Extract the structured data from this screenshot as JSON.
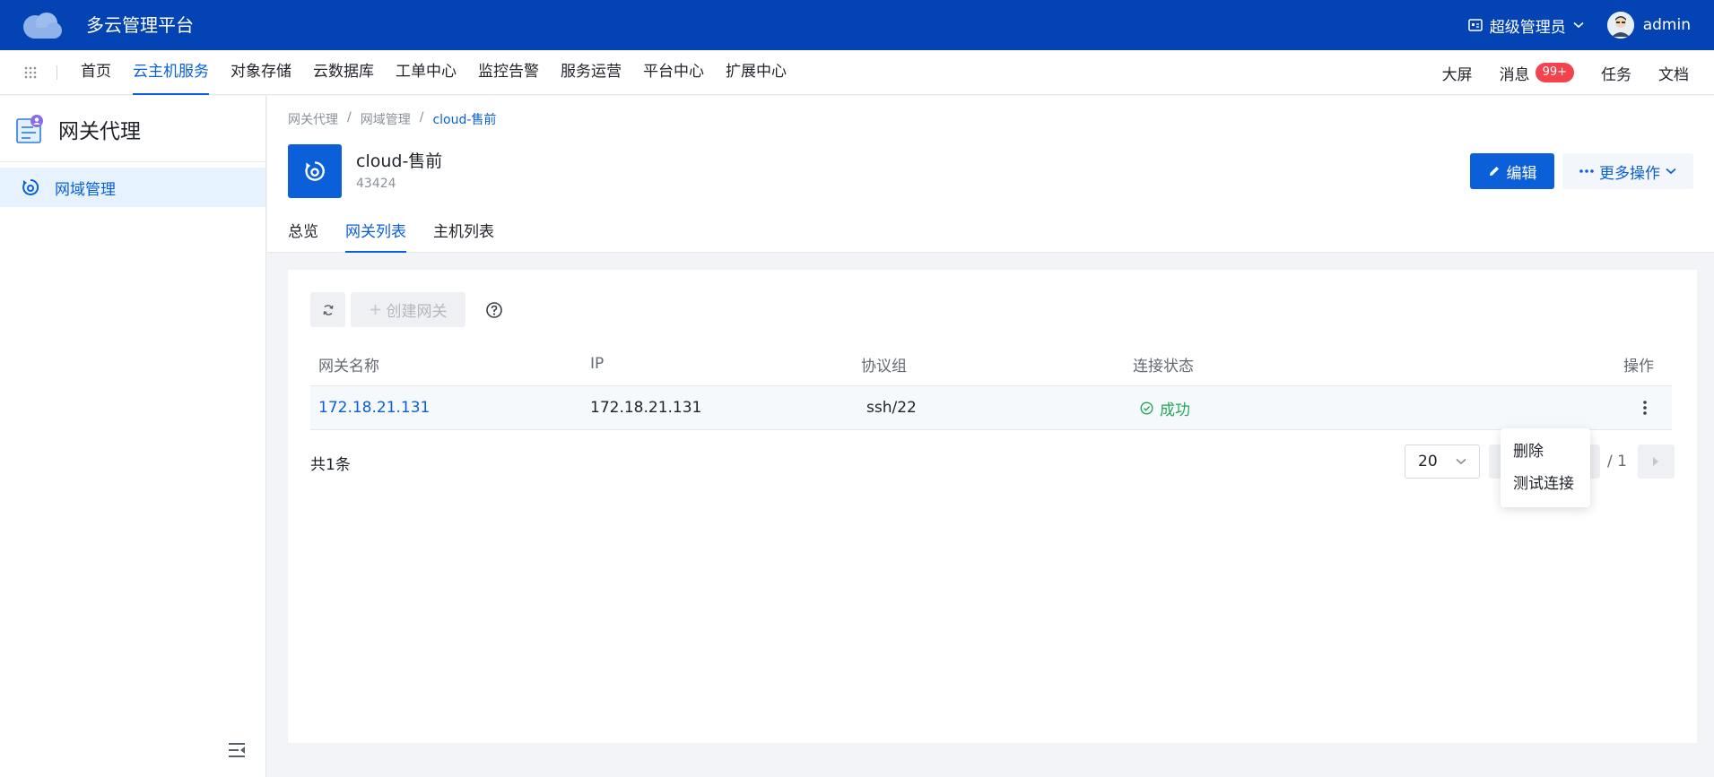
{
  "app": {
    "title": "多云管理平台"
  },
  "topbar": {
    "role": "超级管理员",
    "user": "admin"
  },
  "nav": {
    "items": [
      "首页",
      "云主机服务",
      "对象存储",
      "云数据库",
      "工单中心",
      "监控告警",
      "服务运营",
      "平台中心",
      "扩展中心"
    ],
    "active_index": 1,
    "right": {
      "screen": "大屏",
      "messages": "消息",
      "badge": "99+",
      "tasks": "任务",
      "docs": "文档"
    }
  },
  "sidebar": {
    "title": "网关代理",
    "items": [
      {
        "label": "网域管理",
        "active": true
      }
    ]
  },
  "breadcrumb": [
    "网关代理",
    "网域管理",
    "cloud-售前"
  ],
  "resource": {
    "name": "cloud-售前",
    "id": "43424"
  },
  "actions": {
    "edit": "编辑",
    "more": "更多操作"
  },
  "tabs": [
    "总览",
    "网关列表",
    "主机列表"
  ],
  "toolbar": {
    "create": "创建网关"
  },
  "table": {
    "columns": [
      "网关名称",
      "IP",
      "协议组",
      "连接状态",
      "操作"
    ],
    "rows": [
      {
        "name": "172.18.21.131",
        "ip": "172.18.21.131",
        "protocol": "ssh/22",
        "status": "成功"
      }
    ]
  },
  "footer": {
    "total": "共1条",
    "page_size": "20",
    "page_total": "/ 1"
  },
  "dropdown": {
    "items": [
      "删除",
      "测试连接"
    ]
  },
  "colors": {
    "topbar": "#0343b4",
    "accent": "#0b5fd8",
    "success": "#22a858",
    "badge": "#f2434f"
  }
}
